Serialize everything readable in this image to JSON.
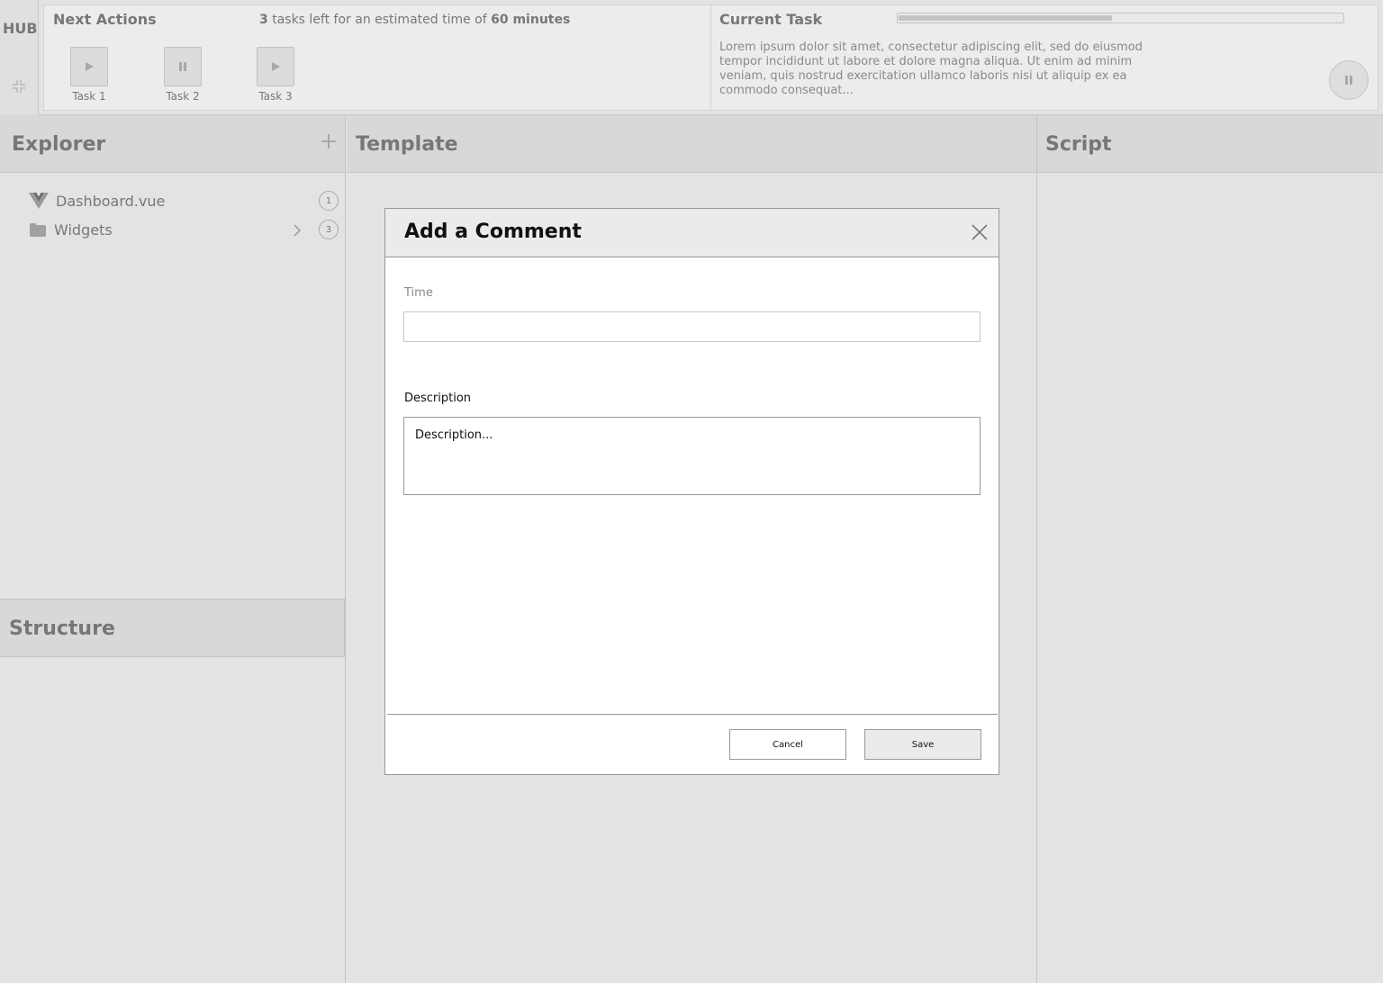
{
  "hub": {
    "label": "HUB",
    "next_actions": {
      "title": "Next Actions",
      "tasks_left": "3",
      "summary_mid": " tasks left for an estimated time of ",
      "estimated_time": "60 minutes",
      "tasks": [
        {
          "label": "Task 1",
          "state_icon": "play-icon"
        },
        {
          "label": "Task 2",
          "state_icon": "pause-icon"
        },
        {
          "label": "Task 3",
          "state_icon": "play-icon"
        }
      ]
    },
    "current_task": {
      "title": "Current Task",
      "progress": 0.48,
      "description": "Lorem ipsum dolor sit amet, consectetur adipiscing elit, sed do eiusmod tempor incididunt ut labore et dolore magna aliqua. Ut enim ad minim veniam, quis nostrud exercitation ullamco laboris nisi ut aliquip ex ea commodo consequat..."
    }
  },
  "panels": {
    "explorer": {
      "title": "Explorer",
      "items": [
        {
          "label": "Dashboard.vue",
          "icon": "vue-logo-icon",
          "badge": "1"
        },
        {
          "label": "Widgets",
          "icon": "folder-icon",
          "badge": "3"
        }
      ]
    },
    "template": {
      "title": "Template"
    },
    "script": {
      "title": "Script"
    },
    "structure": {
      "title": "Structure"
    }
  },
  "modal": {
    "title": "Add a Comment",
    "time_label": "Time",
    "time_value": "",
    "description_label": "Description",
    "description_placeholder": "Description...",
    "cancel_label": "Cancel",
    "save_label": "Save"
  },
  "colors": {
    "background": "#e3e3e3",
    "panel_header": "#d8d8d8",
    "modal_header": "#ebebeb",
    "text_muted": "#777777"
  }
}
